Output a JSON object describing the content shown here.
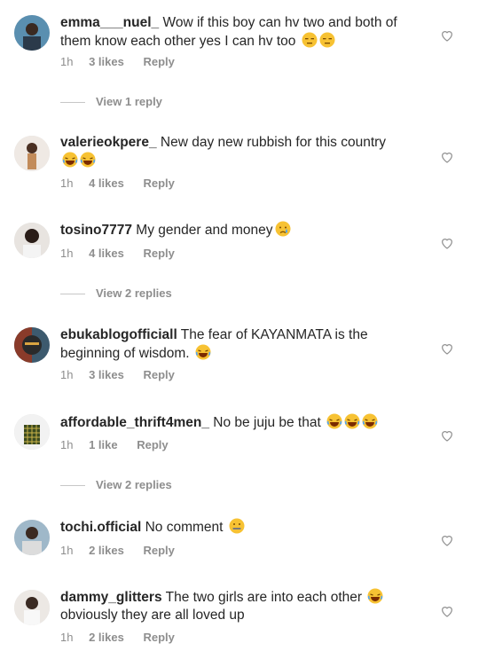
{
  "comments": [
    {
      "user": "emma___nuel_",
      "text": "Wow if this boy can hv two and both of them know each other yes I can hv too",
      "emoji": [
        "expressionless",
        "expressionless"
      ],
      "time": "1h",
      "likes": "3 likes",
      "reply": "Reply",
      "view_replies": "View 1 reply"
    },
    {
      "user": "valerieokpere_",
      "text": "New day new rubbish for this country",
      "emoji": [
        "laugh",
        "laugh"
      ],
      "time": "1h",
      "likes": "4 likes",
      "reply": "Reply"
    },
    {
      "user": "tosino7777",
      "text": "My gender and money",
      "emoji": [
        "cry"
      ],
      "time": "1h",
      "likes": "4 likes",
      "reply": "Reply",
      "view_replies": "View 2 replies"
    },
    {
      "user": "ebukablogofficiall",
      "text": "The fear of KAYANMATA is the beginning of wisdom.",
      "emoji": [
        "laugh"
      ],
      "time": "1h",
      "likes": "3 likes",
      "reply": "Reply"
    },
    {
      "user": "affordable_thrift4men_",
      "text": "No be juju be that",
      "emoji": [
        "laugh",
        "laugh",
        "laugh"
      ],
      "time": "1h",
      "likes": "1 like",
      "reply": "Reply",
      "view_replies": "View 2 replies"
    },
    {
      "user": "tochi.official",
      "text": "No comment",
      "emoji": [
        "zipper"
      ],
      "time": "1h",
      "likes": "2 likes",
      "reply": "Reply"
    },
    {
      "user": "dammy_glitters",
      "text": "The two girls are into each other",
      "text2": "obviously they are all loved up",
      "emoji": [
        "laugh"
      ],
      "time": "1h",
      "likes": "2 likes",
      "reply": "Reply"
    }
  ],
  "colors": {
    "text": "#262626",
    "meta": "#8e8e8e",
    "divider": "#c7c7c7"
  }
}
